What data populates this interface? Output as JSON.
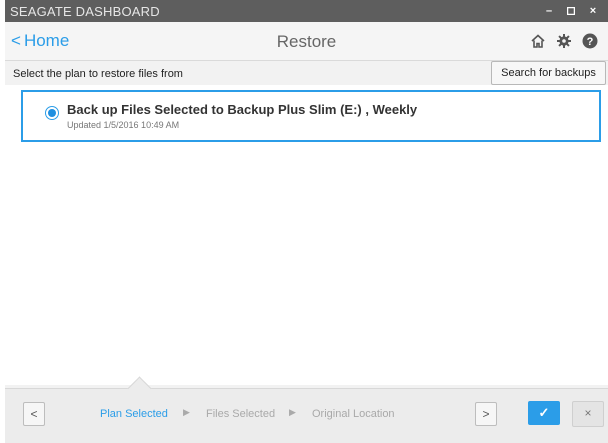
{
  "window": {
    "title": "SEAGATE DASHBOARD",
    "minimize_label": "–",
    "maximize_label": "▫",
    "close_label": "×"
  },
  "header": {
    "back_label": "Home",
    "back_chevron": "<",
    "page_title": "Restore",
    "icons": [
      "home-icon",
      "gear-icon",
      "help-icon"
    ]
  },
  "subbar": {
    "instruction": "Select the plan to restore files from",
    "search_button": "Search for backups"
  },
  "plans": [
    {
      "name": "Back up Files Selected to Backup Plus Slim (E:) , Weekly",
      "updated": "Updated 1/5/2016 10:49 AM",
      "selected": true
    }
  ],
  "footer": {
    "prev_label": "<",
    "next_label": ">",
    "steps": [
      {
        "label": "Plan Selected",
        "active": true
      },
      {
        "label": "Files Selected",
        "active": false
      },
      {
        "label": "Original Location",
        "active": false
      }
    ],
    "step_separator": "▶",
    "confirm_label": "✓",
    "cancel_label": "×"
  },
  "colors": {
    "accent": "#2b9de8",
    "titlebar": "#5e5e5e",
    "inactive_step": "#a9a9a9"
  }
}
